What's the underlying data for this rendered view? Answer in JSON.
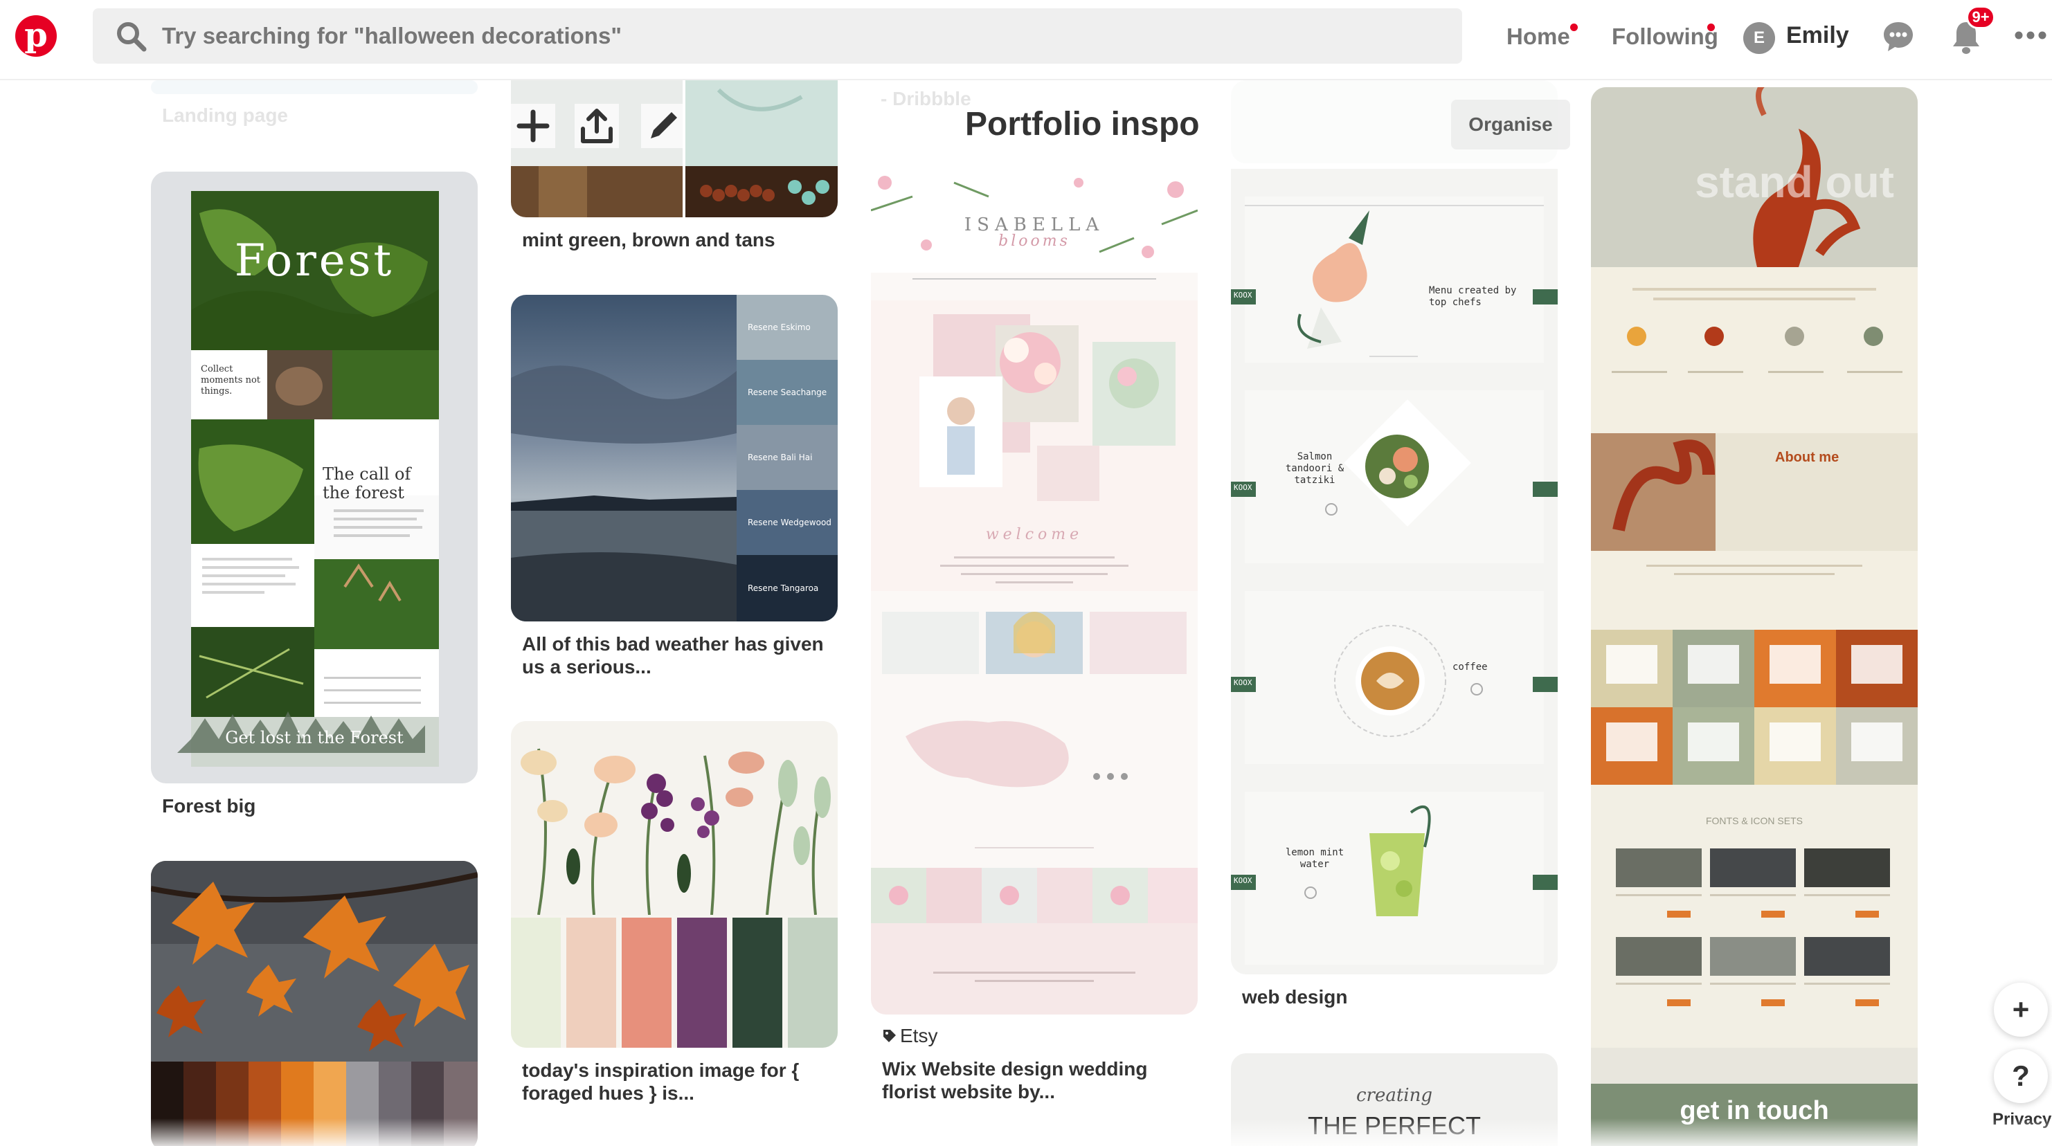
{
  "header": {
    "logo_letter": "p",
    "search_placeholder": "Try searching for \"halloween decorations\"",
    "nav_home": "Home",
    "nav_following": "Following",
    "avatar_initial": "E",
    "user_name": "Emily",
    "notifications_badge": "9+"
  },
  "board": {
    "title": "Portfolio inspo",
    "organise_label": "Organise"
  },
  "faded_top": {
    "landing_page": "Landing page",
    "dribbble": "- Dribbble"
  },
  "pins": {
    "forest": {
      "caption": "Forest big",
      "art_title": "Forest",
      "art_tagline": "Collect moments not things.",
      "art_call": "The call of the forest",
      "art_bottom": "Get lost in the Forest"
    },
    "mint": {
      "caption": "mint green, brown and tans"
    },
    "weather": {
      "caption": "All of this bad weather has given us a serious...",
      "swatches": [
        "Resene Eskimo",
        "Resene Seachange",
        "Resene Bali Hai",
        "Resene Wedgewood",
        "Resene Tangaroa"
      ]
    },
    "foraged": {
      "caption": "today's inspiration image for { foraged hues } is...",
      "colors": [
        "#e8eedb",
        "#efcfbd",
        "#e7907c",
        "#6f3f6d",
        "#2e4637",
        "#c3d2c2"
      ]
    },
    "isabella": {
      "source": "Etsy",
      "caption": "Wix Website design wedding florist website by...",
      "brand_top": "ISABELLA",
      "brand_bottom": "blooms",
      "welcome": "welcome"
    },
    "webdesign": {
      "caption": "web design",
      "menu_text": "Menu created by top chefs",
      "dish1": "Salmon tandoori & tatziki",
      "dish2": "coffee",
      "dish3": "lemon mint water",
      "tag": "KOOX"
    },
    "standout": {
      "hero": "stand out",
      "about": "About me",
      "fonts_heading": "FONTS & ICON SETS",
      "contact": "get in touch"
    },
    "perfect": {
      "script": "creating",
      "headline": "THE PERFECT"
    }
  },
  "actions": {
    "add": "+",
    "help": "?",
    "privacy": "Privacy"
  }
}
